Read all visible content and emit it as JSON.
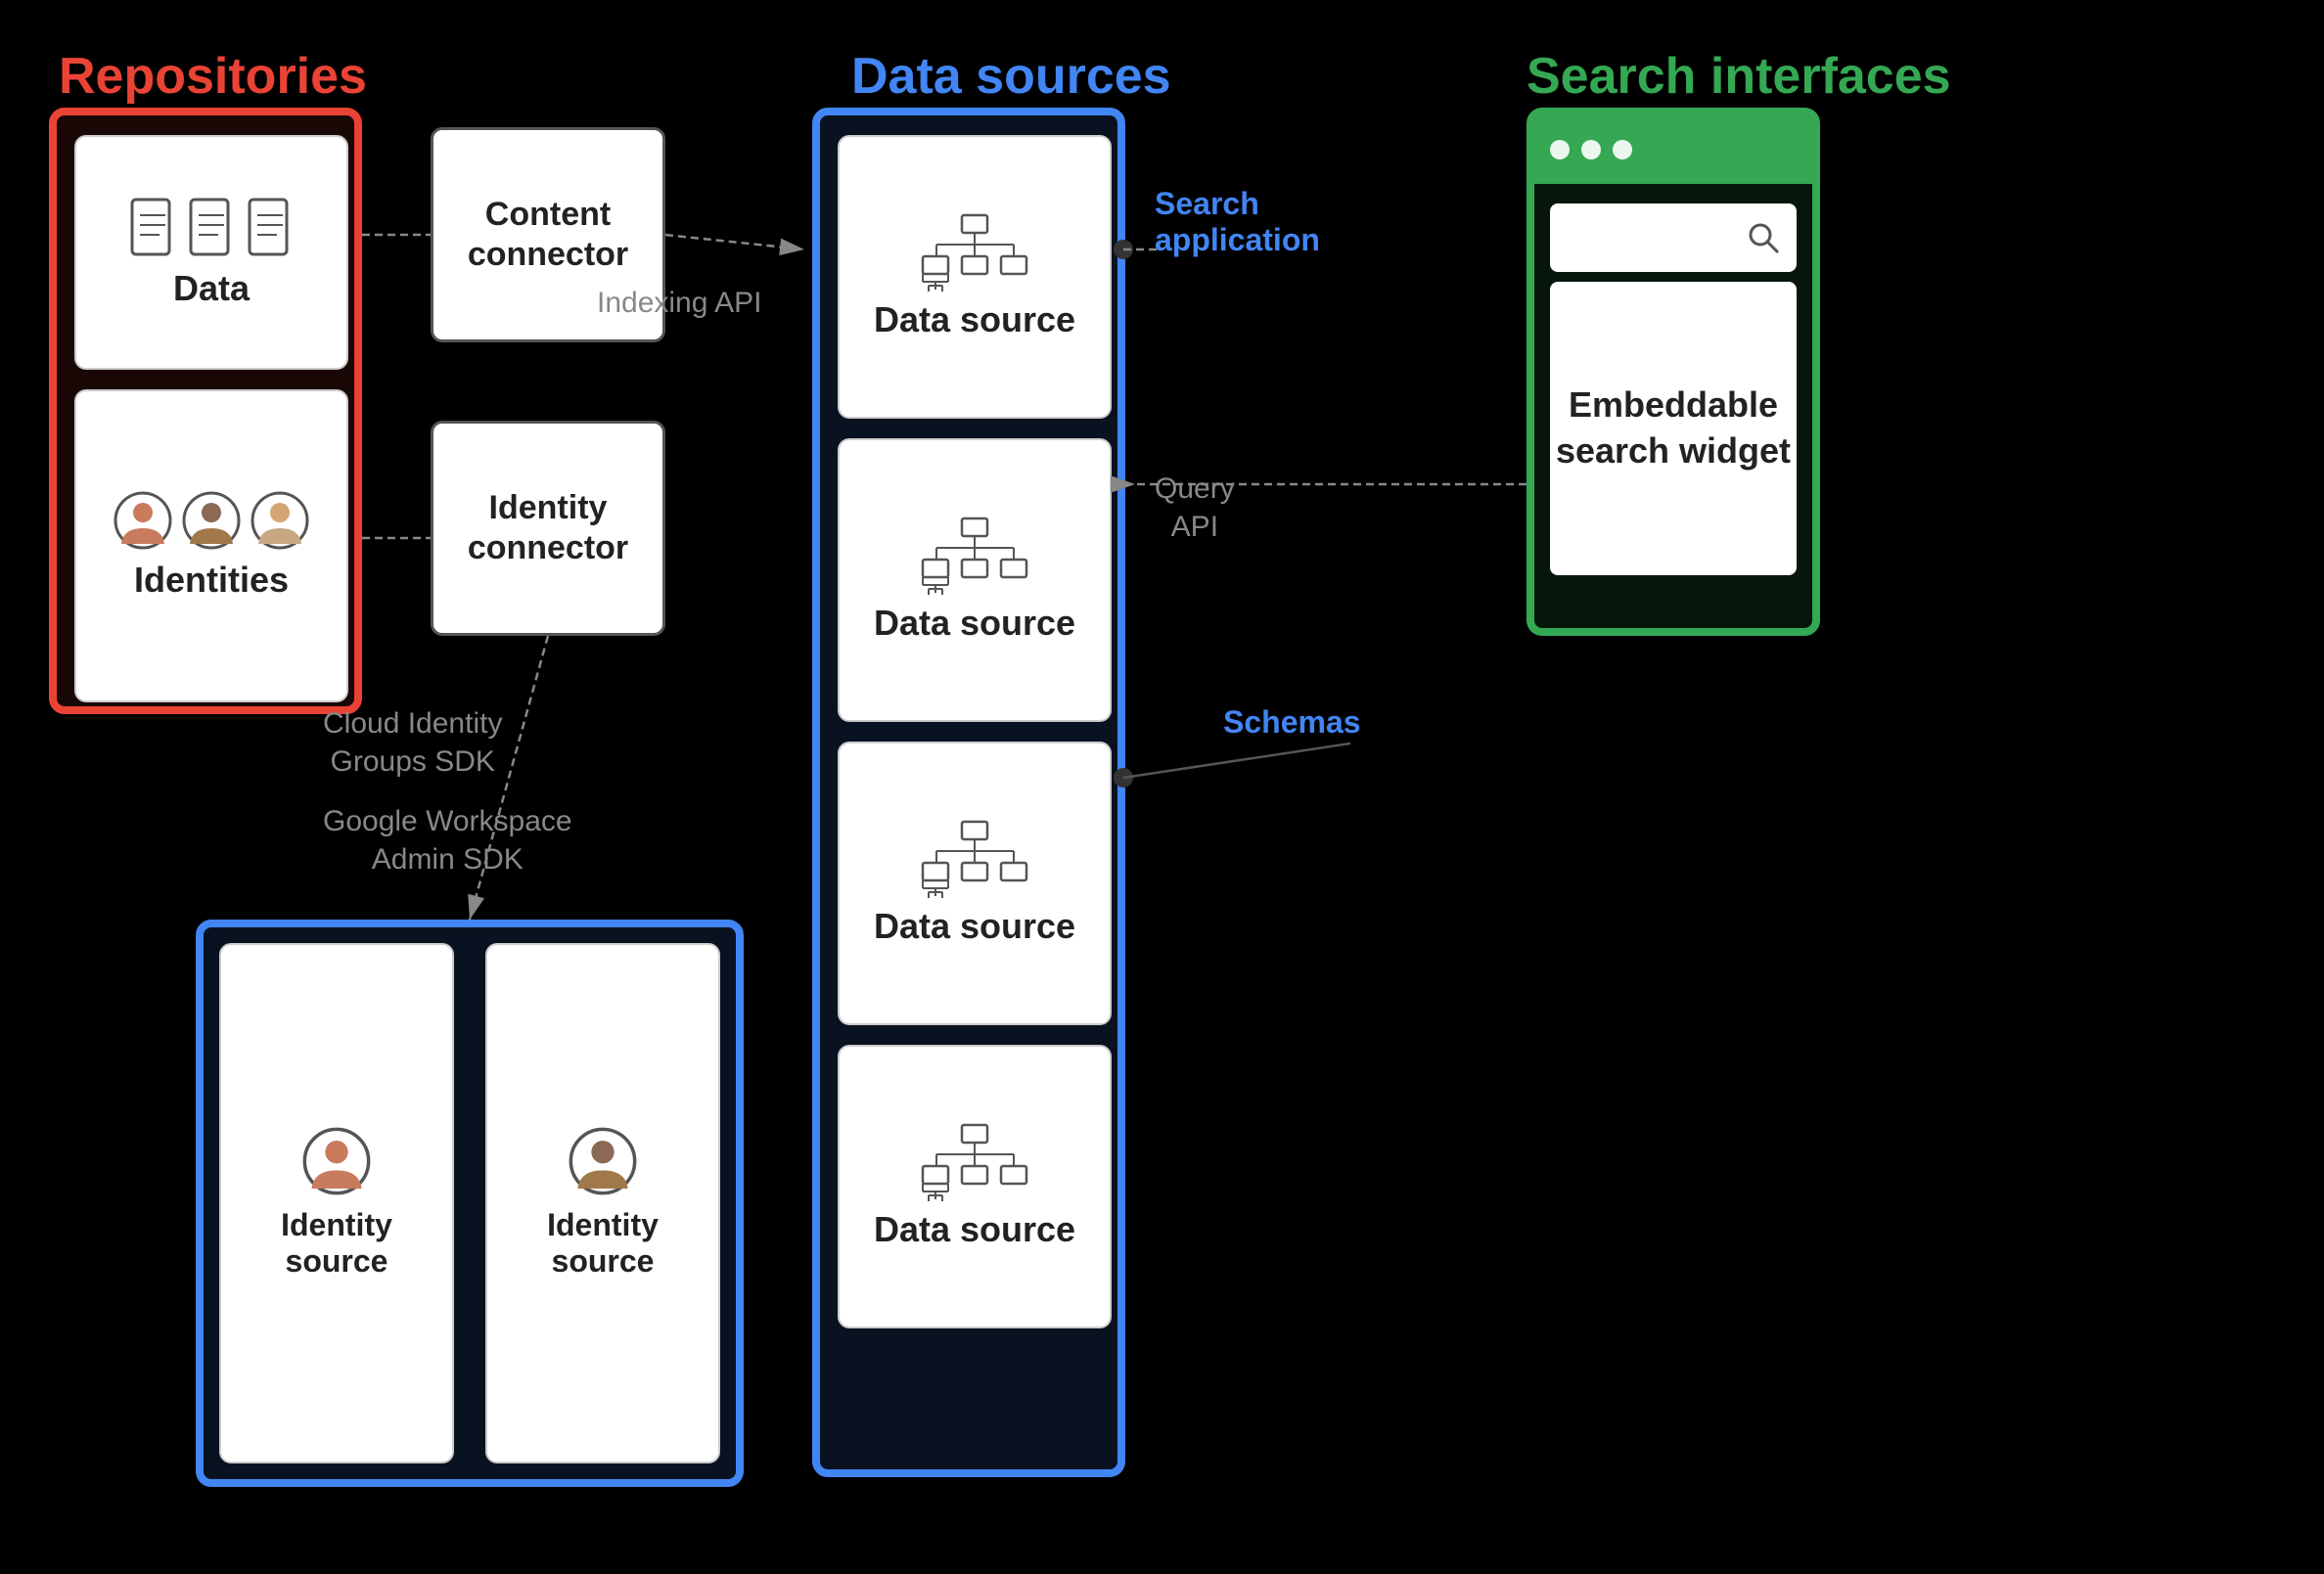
{
  "titles": {
    "repositories": "Repositories",
    "data_sources": "Data sources",
    "search_interfaces": "Search interfaces"
  },
  "repositories": {
    "data_label": "Data",
    "identities_label": "Identities"
  },
  "connectors": {
    "content_connector": "Content\nconnector",
    "identity_connector": "Identity\nconnector",
    "content_connector_line1": "Content",
    "content_connector_line2": "connector",
    "identity_connector_line1": "Identity",
    "identity_connector_line2": "connector"
  },
  "api_labels": {
    "indexing_api": "Indexing API",
    "query_api": "Query\nAPI",
    "cloud_identity": "Cloud Identity\nGroups SDK",
    "google_workspace": "Google Workspace\nAdmin SDK"
  },
  "data_sources": {
    "label": "Data source",
    "count": 4
  },
  "search_interfaces": {
    "search_label": "Search",
    "widget_label": "Embeddable\nsearch\nwidget"
  },
  "identity_sources": {
    "label": "Identity\nsource",
    "count": 2
  },
  "annotations": {
    "search_application": "Search\napplication",
    "schemas": "Schemas",
    "query_api": "Query\nAPI"
  },
  "colors": {
    "red": "#EA4335",
    "blue": "#4285F4",
    "green": "#34A853",
    "gray": "#888888",
    "black": "#000000",
    "white": "#ffffff"
  }
}
